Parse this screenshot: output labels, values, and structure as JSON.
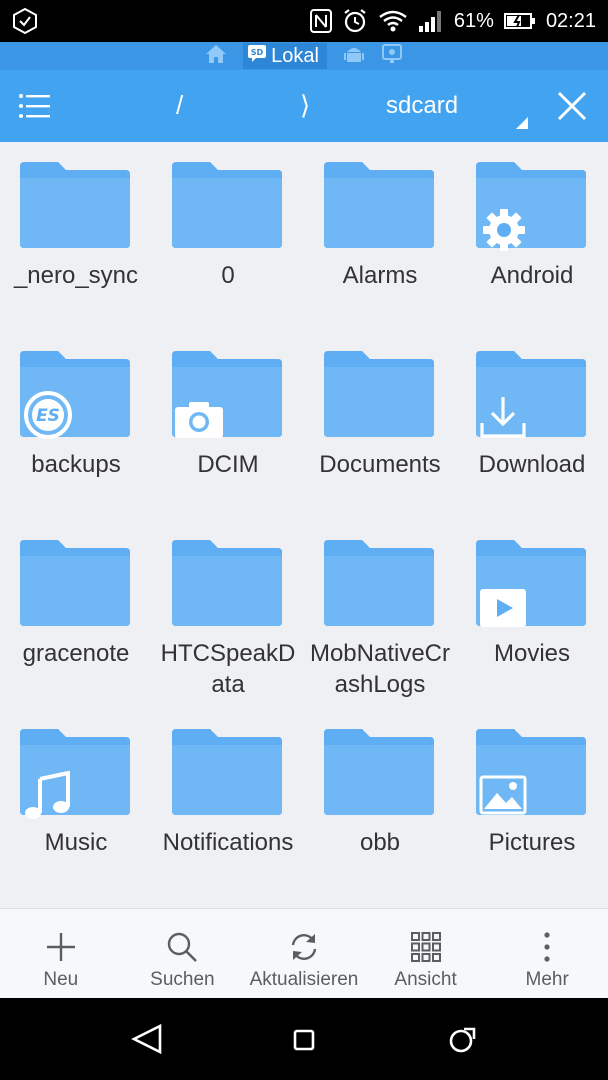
{
  "status_bar": {
    "battery": "61%",
    "time": "02:21"
  },
  "location_strip": {
    "active_label": "Lokal"
  },
  "toolbar": {
    "separator": "/",
    "chevron": "⟩",
    "current_path": "sdcard"
  },
  "folders": [
    {
      "name": "_nero_sync",
      "badge": null
    },
    {
      "name": "0",
      "badge": null
    },
    {
      "name": "Alarms",
      "badge": null
    },
    {
      "name": "Android",
      "badge": "gear-icon"
    },
    {
      "name": "backups",
      "badge": "es-logo-icon"
    },
    {
      "name": "DCIM",
      "badge": "camera-icon"
    },
    {
      "name": "Documents",
      "badge": null
    },
    {
      "name": "Download",
      "badge": "download-icon"
    },
    {
      "name": "gracenote",
      "badge": null
    },
    {
      "name": "HTCSpeakData",
      "badge": null
    },
    {
      "name": "MobNativeCrashLogs",
      "badge": null
    },
    {
      "name": "Movies",
      "badge": "play-icon"
    },
    {
      "name": "Music",
      "badge": "music-note-icon"
    },
    {
      "name": "Notifications",
      "badge": null
    },
    {
      "name": "obb",
      "badge": null
    },
    {
      "name": "Pictures",
      "badge": "image-icon"
    }
  ],
  "bottom_bar": {
    "items": [
      {
        "label": "Neu",
        "icon": "plus-icon"
      },
      {
        "label": "Suchen",
        "icon": "search-icon"
      },
      {
        "label": "Aktualisieren",
        "icon": "refresh-icon"
      },
      {
        "label": "Ansicht",
        "icon": "grid-icon"
      },
      {
        "label": "Mehr",
        "icon": "more-icon"
      }
    ]
  },
  "colors": {
    "toolbar": "#42a3f0",
    "location_strip": "#3b97e6",
    "folder_back": "#5fadf2",
    "folder_front": "#6fb8f5"
  }
}
